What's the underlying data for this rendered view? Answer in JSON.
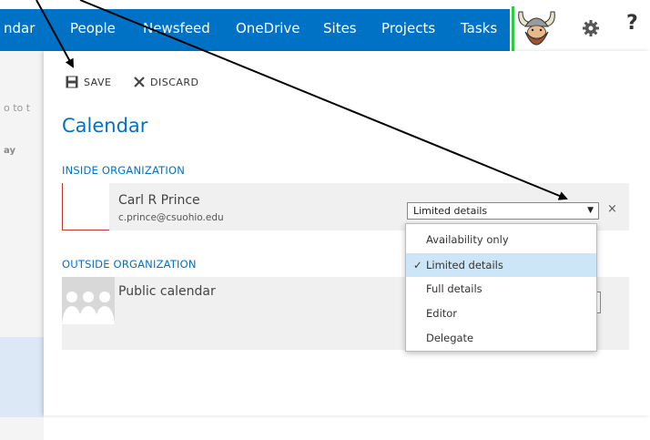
{
  "nav": {
    "items": [
      "ndar",
      "People",
      "Newsfeed",
      "OneDrive",
      "Sites",
      "Projects",
      "Tasks"
    ],
    "help_label": "?"
  },
  "background": {
    "text1": "o to t",
    "text2": "ay"
  },
  "toolbar": {
    "save_label": "SAVE",
    "discard_label": "DISCARD"
  },
  "page": {
    "title": "Calendar"
  },
  "inside": {
    "label": "INSIDE ORGANIZATION",
    "person": {
      "name": "Carl R Prince",
      "email": "c.prince@csuohio.edu",
      "permission": "Limited details",
      "remove": "×"
    }
  },
  "outside": {
    "label": "OUTSIDE ORGANIZATION",
    "public_name": "Public calendar"
  },
  "dropdown": {
    "options": [
      "Availability only",
      "Limited details",
      "Full details",
      "Editor",
      "Delegate"
    ],
    "selected_index": 1,
    "check_mark": "✓"
  },
  "colors": {
    "brand": "#0072c6",
    "selected_option": "#cde6f7"
  }
}
